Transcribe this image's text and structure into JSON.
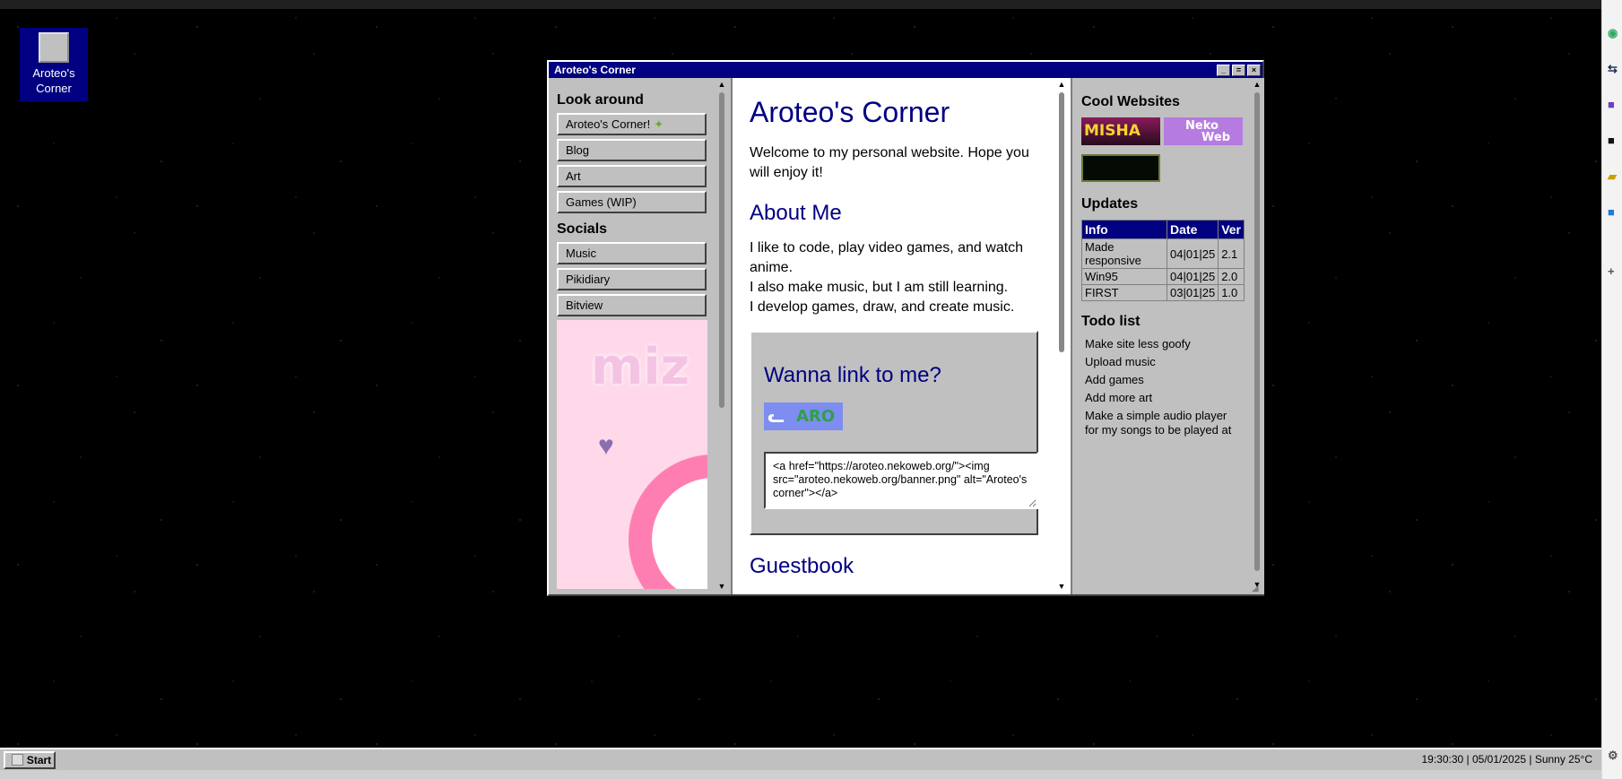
{
  "desktop": {
    "icon_label_1": "Aroteo's",
    "icon_label_2": "Corner"
  },
  "window": {
    "title": "Aroteo's Corner",
    "controls": {
      "minimize": "_",
      "maximize": "=",
      "close": "×"
    }
  },
  "left": {
    "look_around": "Look around",
    "nav": [
      "Aroteo's Corner!",
      "Blog",
      "Art",
      "Games (WIP)"
    ],
    "socials": "Socials",
    "social_links": [
      "Music",
      "Pikidiary",
      "Bitview"
    ],
    "promo_text": "miz"
  },
  "main": {
    "title": "Aroteo's Corner",
    "welcome": "Welcome to my personal website. Hope you will enjoy it!",
    "about_heading": "About Me",
    "about_lines": [
      "I like to code, play video games, and watch anime.",
      "I also make music, but I am still learning.",
      "I develop games, draw, and create music."
    ],
    "link_heading": "Wanna link to me?",
    "badge_text": "ARO",
    "code_snippet": "<a href=\"https://aroteo.nekoweb.org/\"><img src=\"aroteo.nekoweb.org/banner.png\" alt=\"Aroteo's corner\"></a>",
    "guestbook_heading": "Guestbook"
  },
  "right": {
    "cool_heading": "Cool Websites",
    "banner_misha": "MISHA",
    "banner_neko_1": "Neko",
    "banner_neko_2": "Web",
    "updates_heading": "Updates",
    "updates_headers": [
      "Info",
      "Date",
      "Ver"
    ],
    "updates_rows": [
      {
        "info": "Made responsive",
        "date": "04|01|25",
        "ver": "2.1"
      },
      {
        "info": "Win95",
        "date": "04|01|25",
        "ver": "2.0"
      },
      {
        "info": "FIRST",
        "date": "03|01|25",
        "ver": "1.0"
      }
    ],
    "todo_heading": "Todo list",
    "todo_items": [
      "Make site less goofy",
      "Upload music",
      "Add games",
      "Add more art",
      "Make a simple audio player for my songs to be played at"
    ]
  },
  "taskbar": {
    "start_label": "Start",
    "status": "19:30:30 | 05/01/2025 | Sunny 25°C"
  },
  "icons": {
    "star": "star-icon",
    "cat": "cat-icon",
    "heart": "heart-icon"
  },
  "colors": {
    "titlebar": "#000080",
    "heading": "#000080",
    "chrome": "#c0c0c0"
  }
}
